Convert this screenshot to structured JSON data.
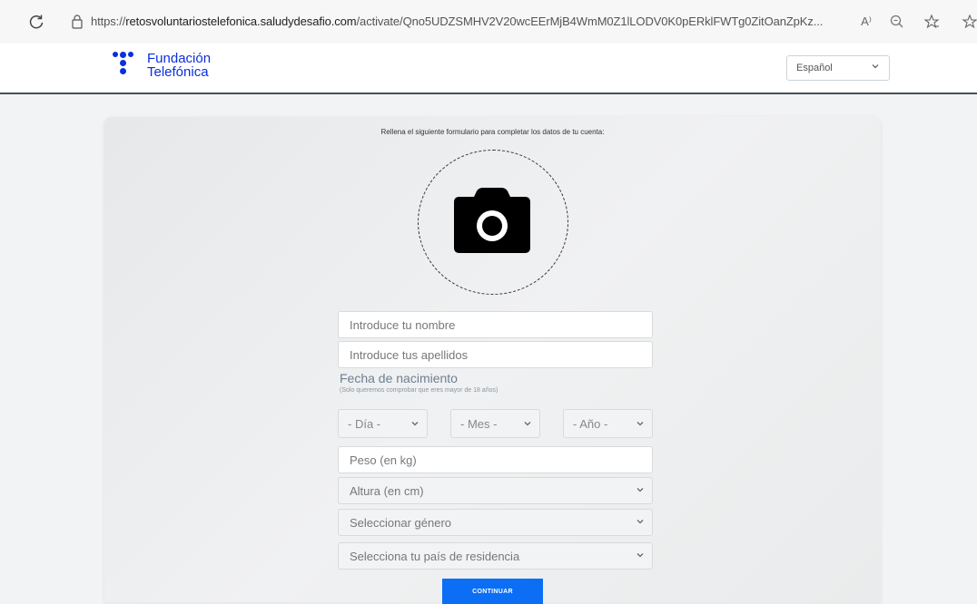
{
  "browser": {
    "url_prefix": "https://",
    "url_host": "retosvoluntariostelefonica.saludydesafio.com",
    "url_path": "/activate/Qno5UDZSMHV2V20wcEErMjB4WmM0Z1lLODV0K0pERklFWTg0ZitOanZpKz...",
    "read_aloud_label": "A⁾"
  },
  "header": {
    "logo_line1": "Fundación",
    "logo_line2": "Telefónica",
    "language_selected": "Español",
    "brand_color": "#0b2ee0"
  },
  "form": {
    "intro": "Rellena el siguiente formulario para completar los datos de tu cuenta:",
    "name_placeholder": "Introduce tu nombre",
    "surname_placeholder": "Introduce tus apellidos",
    "dob_label": "Fecha de nacimiento",
    "dob_note": "(Solo queremos comprobar que eres mayor de 18 años)",
    "day_placeholder": "- Día -",
    "month_placeholder": "- Mes -",
    "year_placeholder": "- Año -",
    "weight_placeholder": "Peso (en kg)",
    "height_placeholder": "Altura (en cm)",
    "gender_placeholder": "Seleccionar género",
    "country_placeholder": "Selecciona tu país de residencia",
    "continue_label": "CONTINUAR",
    "button_color": "#0b6ef5"
  }
}
